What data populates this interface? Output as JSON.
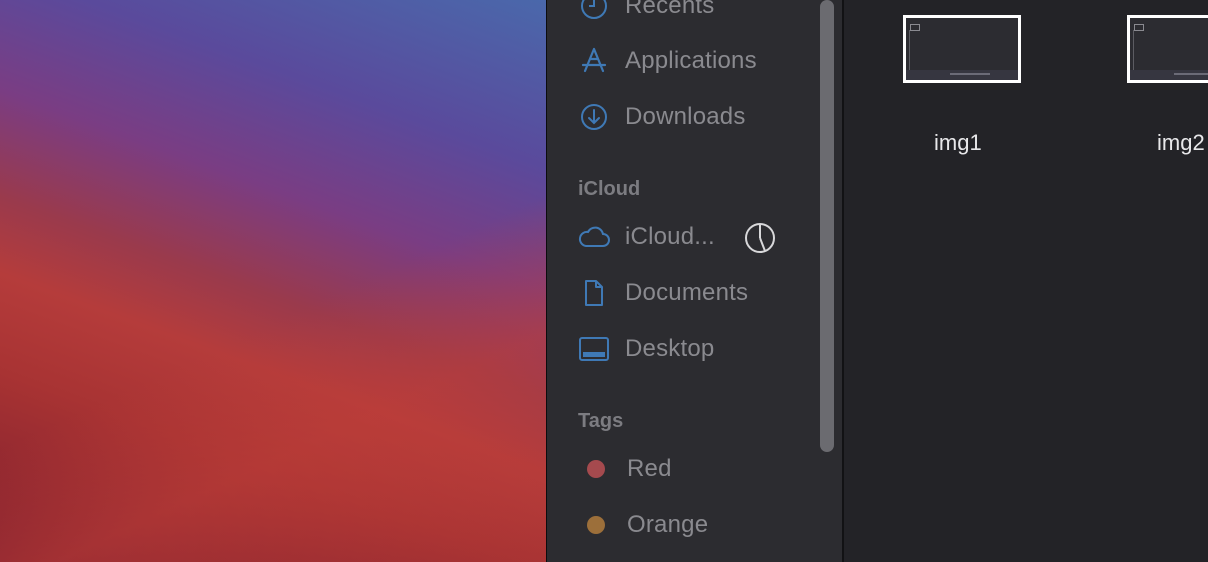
{
  "sidebar": {
    "favorites": [
      {
        "label": "Recents",
        "icon": "clock-icon"
      },
      {
        "label": "Applications",
        "icon": "applications-icon"
      },
      {
        "label": "Downloads",
        "icon": "download-icon"
      }
    ],
    "icloud_header": "iCloud",
    "icloud": [
      {
        "label": "iCloud...",
        "icon": "cloud-icon"
      },
      {
        "label": "Documents",
        "icon": "document-icon"
      },
      {
        "label": "Desktop",
        "icon": "desktop-icon"
      }
    ],
    "tags_header": "Tags",
    "tags": [
      {
        "label": "Red",
        "color": "#a54a4e"
      },
      {
        "label": "Orange",
        "color": "#9c6f3a"
      }
    ]
  },
  "files": [
    {
      "name": "img1"
    },
    {
      "name": "img2"
    }
  ],
  "colors": {
    "icon_blue": "#3f79b5",
    "sidebar_text": "#8a8a8f"
  }
}
